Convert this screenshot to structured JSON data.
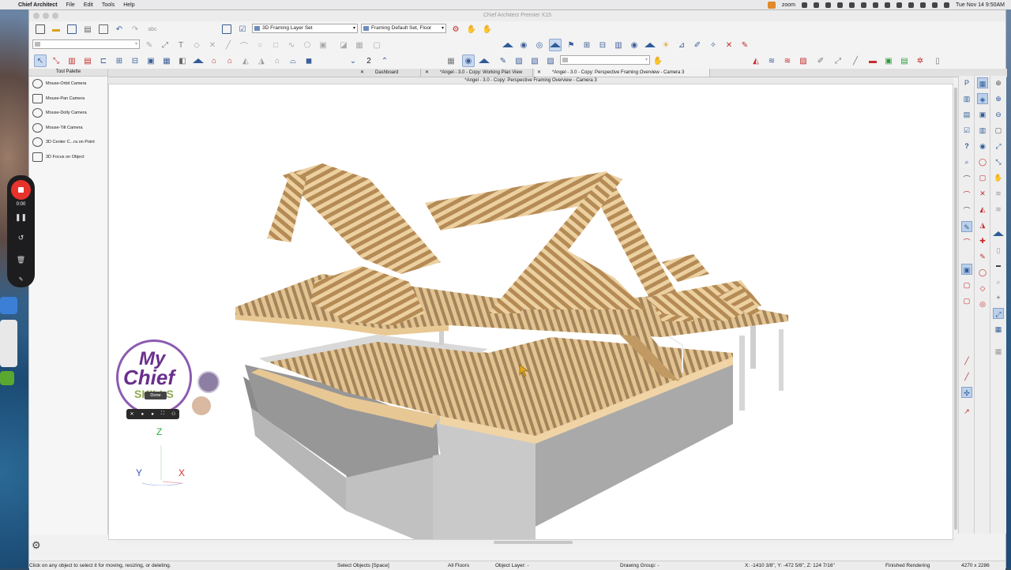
{
  "menubar": {
    "app_name": "Chief Architect",
    "menus": [
      "File",
      "Edit",
      "Tools",
      "Help"
    ],
    "zoom_label": "zoom",
    "clock": "Tue Nov 14  9:50AM"
  },
  "window": {
    "title": "Chief Architect Premier X15"
  },
  "toolbar": {
    "layer_set": "3D Framing Layer Set",
    "default_set": "Framing Default Set, Floor",
    "floor_number": "2"
  },
  "palette": {
    "title": "Tool Palette",
    "items": [
      "Mouse-Orbit Camera",
      "Mouse-Pan Camera",
      "Mouse-Dolly Camera",
      "Mouse-Tilt Camera",
      "3D Center C...ra on Point",
      "3D Focus on Object"
    ]
  },
  "tabs": [
    {
      "label": "Dashboard"
    },
    {
      "label": "*Angel - 3.0 - Copy: Working Plan View"
    },
    {
      "label": "*Angel - 3.0 - Copy: Perspective Framing Overview - Camera 3"
    }
  ],
  "view_title": "*Angel - 3.0 - Copy: Perspective Framing Overview - Camera 3",
  "recorder": {
    "time": "0:00"
  },
  "overlay": {
    "logo_line1": "My",
    "logo_line2": "Chief",
    "logo_line3": "SKILLS",
    "done_label": "Done"
  },
  "axes": {
    "z": "Z",
    "y": "Y",
    "x": "X"
  },
  "status": {
    "hint": "Click on any object to select it for moving, resizing, or deleting.",
    "mode": "Select Objects [Space]",
    "floors": "All Floors",
    "object_layer": "Object Layer: -",
    "drawing_group": "Drawing Group: -",
    "coords": "X: -1410 3/8\", Y: -472 5/8\", Z: 124 7/16\"",
    "rendering": "Finished Rendering",
    "size": "4270 x 2286"
  }
}
